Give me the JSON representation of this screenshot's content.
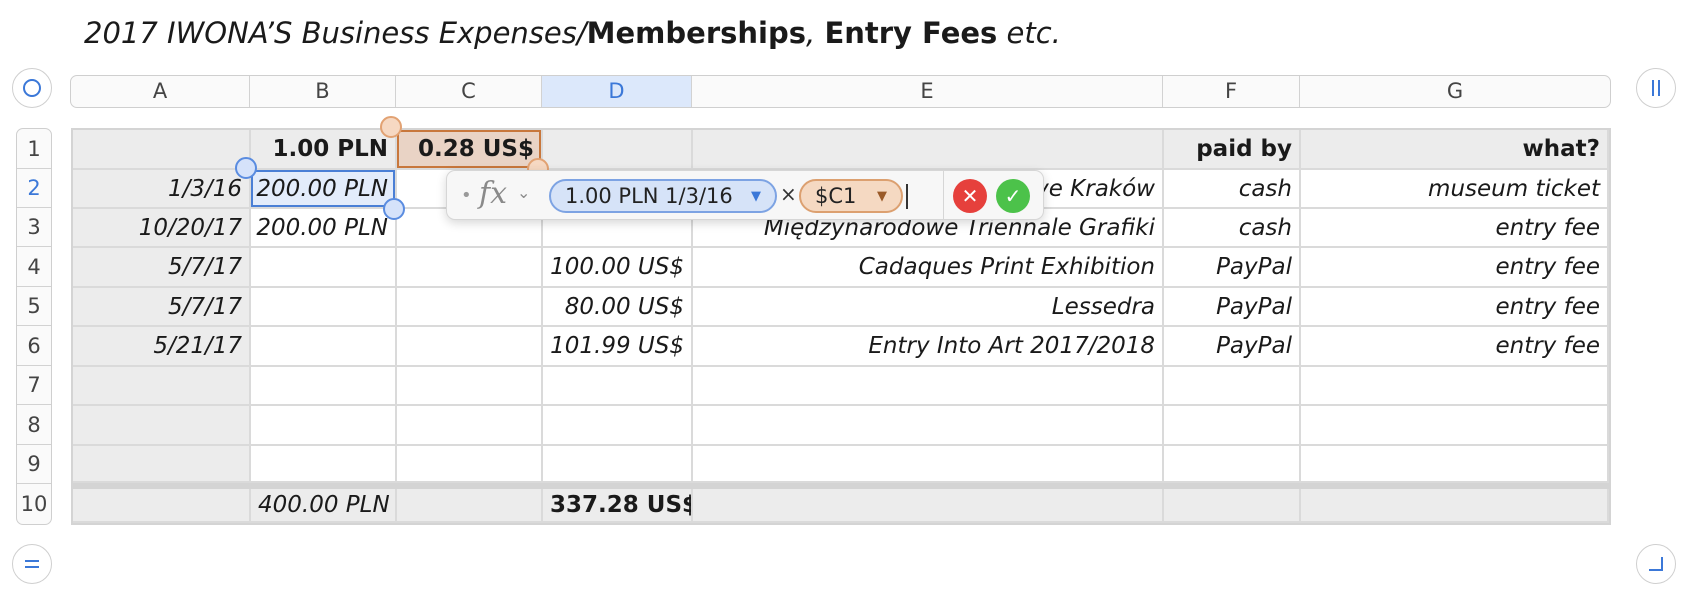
{
  "title": {
    "part1": "2017 IWONA’S Business Expenses/",
    "part2": "Memberships",
    "part3": ", ",
    "part4": "Entry Fees",
    "part5": " etc."
  },
  "columns": [
    "A",
    "B",
    "C",
    "D",
    "E",
    "F",
    "G"
  ],
  "selected_column": "D",
  "rows": [
    "1",
    "2",
    "3",
    "4",
    "5",
    "6",
    "7",
    "8",
    "9",
    "10"
  ],
  "selected_row": "2",
  "header_row": {
    "A": "",
    "B": "1.00 PLN",
    "C": "0.28 US$",
    "D": "",
    "E": "",
    "F": "paid by",
    "G": "what?"
  },
  "body_rows": [
    {
      "A": "1/3/16",
      "B": "200.00 PLN",
      "C": "",
      "D": "",
      "E": "ve Kraków",
      "F": "cash",
      "G": "museum ticket"
    },
    {
      "A": "10/20/17",
      "B": "200.00 PLN",
      "C": "",
      "D": "",
      "E": "Międzynarodowe Triennale Grafiki",
      "F": "cash",
      "G": "entry fee"
    },
    {
      "A": "5/7/17",
      "B": "",
      "C": "",
      "D": "100.00 US$",
      "E": "Cadaques Print Exhibition",
      "F": "PayPal",
      "G": "entry fee"
    },
    {
      "A": "5/7/17",
      "B": "",
      "C": "",
      "D": "80.00 US$",
      "E": "Lessedra",
      "F": "PayPal",
      "G": "entry fee"
    },
    {
      "A": "5/21/17",
      "B": "",
      "C": "",
      "D": "101.99 US$",
      "E": "Entry Into Art 2017/2018",
      "F": "PayPal",
      "G": "entry fee"
    },
    {
      "A": "",
      "B": "",
      "C": "",
      "D": "",
      "E": "",
      "F": "",
      "G": ""
    },
    {
      "A": "",
      "B": "",
      "C": "",
      "D": "",
      "E": "",
      "F": "",
      "G": ""
    },
    {
      "A": "",
      "B": "",
      "C": "",
      "D": "",
      "E": "",
      "F": "",
      "G": ""
    }
  ],
  "footer_row": {
    "A": "",
    "B": "400.00 PLN",
    "C": "",
    "D": "337.28 US$",
    "E": "",
    "F": "",
    "G": ""
  },
  "formula_editor": {
    "fx_label": "fx",
    "token1": "1.00 PLN 1/3/16",
    "operator": "×",
    "token2": "$C1",
    "cancel_glyph": "✕",
    "accept_glyph": "✓"
  },
  "icons": {
    "table-select": "circle-icon",
    "add-column": "pause-bars-icon",
    "add-row": "equals-icon",
    "resize": "corner-icon"
  },
  "colors": {
    "selection_blue": "#4a7fd6",
    "reference_orange": "#c8773c",
    "cancel_red": "#e6403c",
    "accept_green": "#4cc24a"
  }
}
